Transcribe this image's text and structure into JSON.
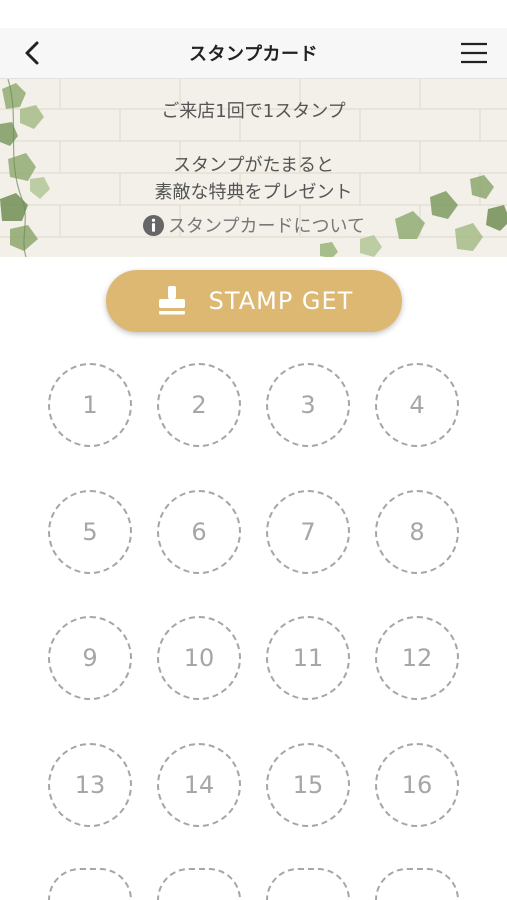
{
  "header": {
    "title": "スタンプカード",
    "back_icon": "chevron-left-icon",
    "menu_icon": "hamburger-menu-icon"
  },
  "banner": {
    "line1": "ご来店1回で1スタンプ",
    "line2": "スタンプがたまると",
    "line3": "素敵な特典をプレゼント",
    "link_text": "スタンプカードについて",
    "link_icon": "info-icon"
  },
  "stamp_button": {
    "label": "STAMP GET",
    "icon": "stamp-icon",
    "color": "#dcb872"
  },
  "slots": [
    "1",
    "2",
    "3",
    "4",
    "5",
    "6",
    "7",
    "8",
    "9",
    "10",
    "11",
    "12",
    "13",
    "14",
    "15",
    "16"
  ],
  "colors": {
    "accent": "#dcb872",
    "slot_border": "#a6a6a6"
  }
}
